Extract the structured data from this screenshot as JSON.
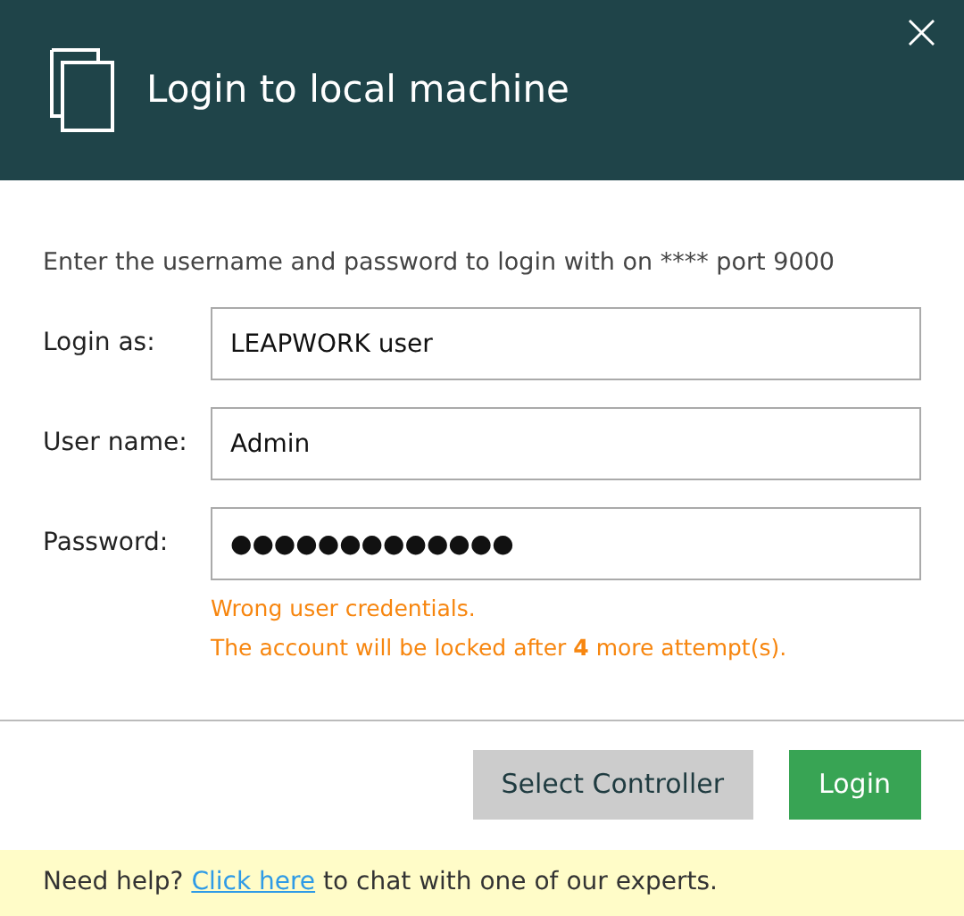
{
  "header": {
    "title": "Login to local machine",
    "close": "×"
  },
  "intro": "Enter the username and password to login with on **** port 9000",
  "fields": [
    {
      "label": "Login as:",
      "value": "LEAPWORK user"
    },
    {
      "label": "User name:",
      "value": "Admin"
    },
    {
      "label": "Password:",
      "value": "●●●●●●●●●●●●●"
    }
  ],
  "errors": [
    "Wrong user credentials.",
    "The account will be locked after **4** more attempt(s)."
  ],
  "buttons": [
    {
      "label": "Select Controller",
      "kind": "secondary"
    },
    {
      "label": "Login",
      "kind": "primary"
    }
  ],
  "footer": {
    "before": "Need help?",
    "link": "Click here",
    "after": "to chat with one of our experts."
  }
}
